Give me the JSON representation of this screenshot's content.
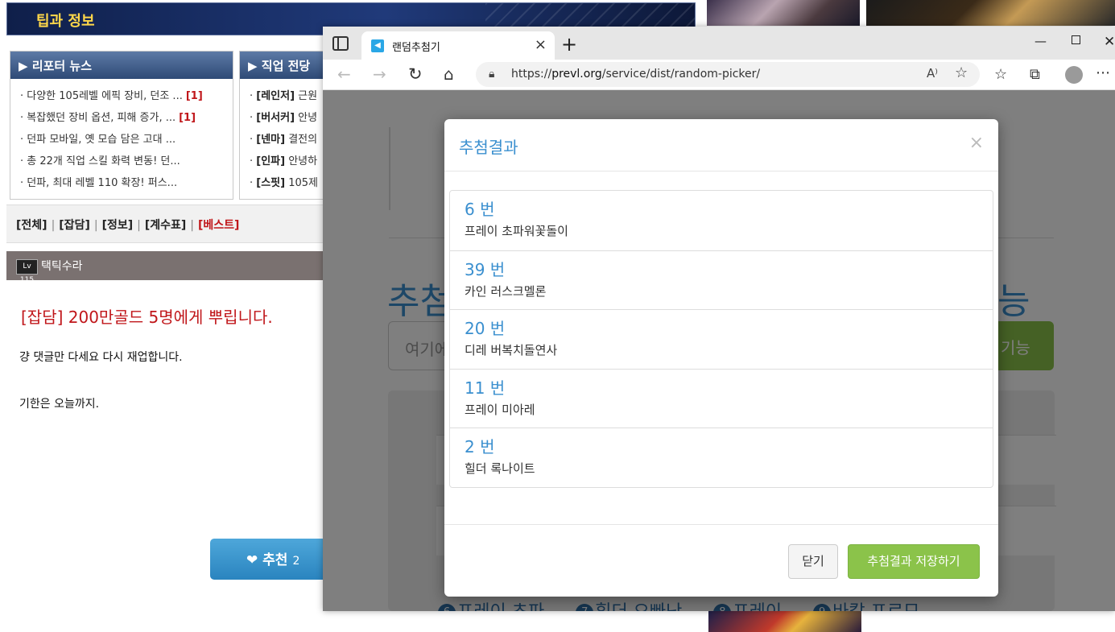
{
  "forum": {
    "section_title": "팁과 정보",
    "reporter_news": {
      "title": "리포터 뉴스",
      "items": [
        {
          "text": "다양한 105레벨 에픽 장비, 던조 ...",
          "count": "[1]"
        },
        {
          "text": "복잡했던 장비 옵션, 피해 증가, ...",
          "count": "[1]"
        },
        {
          "text": "던파 모바일, 옛 모습 담은 고대 ...",
          "count": ""
        },
        {
          "text": "총 22개 직업 스킬 화력 변동! 던...",
          "count": ""
        },
        {
          "text": "던파, 최대 레벨 110 확장! 퍼스...",
          "count": ""
        }
      ]
    },
    "job_hall": {
      "title": "직업 전당",
      "items": [
        {
          "tag": "[레인저]",
          "text": "근원"
        },
        {
          "tag": "[버서커]",
          "text": "안녕"
        },
        {
          "tag": "[넨마]",
          "text": "결전의"
        },
        {
          "tag": "[인파]",
          "text": "안녕하"
        },
        {
          "tag": "[스핏]",
          "text": "105제"
        }
      ]
    },
    "categories": [
      "[전체]",
      "[잡담]",
      "[정보]",
      "[계수표]",
      "[베스트]"
    ],
    "author": {
      "level": "Lv 115",
      "name": "택틱수라"
    },
    "post": {
      "title": "[잡담] 200만골드 5명에게 뿌립니다.",
      "line1": "걍 댓글만 다세요 다시 재업합니다.",
      "line2": "기한은 오늘까지."
    },
    "recommend": {
      "label": "추천",
      "count": "2"
    }
  },
  "browser": {
    "tab_title": "랜덤추첨기",
    "url_scheme": "https://",
    "url_host": "prevl.org",
    "url_path": "/service/dist/random-picker/"
  },
  "page": {
    "heading_left": "추첨",
    "heading_right": "능",
    "input_placeholder": "여기에",
    "add_button": "기능",
    "chips": [
      {
        "num": "6",
        "label": "프레이 초파"
      },
      {
        "num": "7",
        "label": "힐더 오빠난"
      },
      {
        "num": "8",
        "label": "프레이"
      },
      {
        "num": "9",
        "label": "바칼 프르므"
      }
    ]
  },
  "modal": {
    "title": "추첨결과",
    "close_x": "×",
    "results": [
      {
        "number": "6 번",
        "name": "프레이 초파워꽃돌이"
      },
      {
        "number": "39 번",
        "name": "카인 러스크멜론"
      },
      {
        "number": "20 번",
        "name": "디레 버복치돌연사"
      },
      {
        "number": "11 번",
        "name": "프레이 미아레"
      },
      {
        "number": "2 번",
        "name": "힐더 록나이트"
      }
    ],
    "close_button": "닫기",
    "save_button": "추첨결과 저장하기"
  },
  "colors": {
    "accent_blue": "#3a8fcf",
    "save_green": "#8bc34a",
    "forum_red": "#c0161a"
  }
}
